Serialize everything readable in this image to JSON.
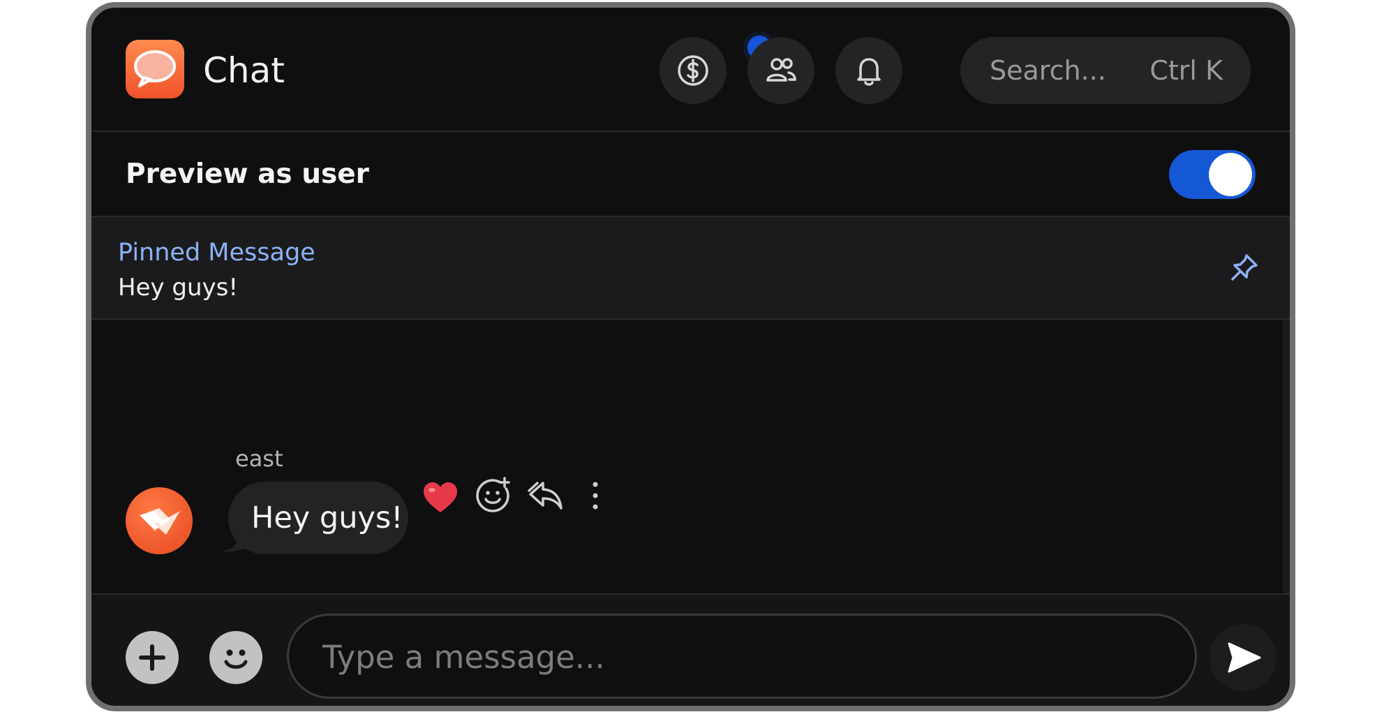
{
  "app": {
    "title": "Chat",
    "logo_icon": "speech-bubble-logo"
  },
  "header": {
    "icons": [
      "dollar-circle-icon",
      "users-icon",
      "bell-icon"
    ],
    "notification_badge_color": "#1556d9",
    "search": {
      "placeholder": "Search...",
      "shortcut": "Ctrl K"
    }
  },
  "preview": {
    "label": "Preview as user",
    "toggle_on": true,
    "toggle_color": "#1558d6"
  },
  "pinned": {
    "title": "Pinned Message",
    "text": "Hey guys!",
    "title_color": "#8db2f5"
  },
  "messages": [
    {
      "sender": "east",
      "text": "Hey guys!",
      "actions": [
        "heart-reaction-icon",
        "add-reaction-icon",
        "reply-icon",
        "more-options-icon"
      ]
    }
  ],
  "composer": {
    "placeholder": "Type a message..."
  }
}
